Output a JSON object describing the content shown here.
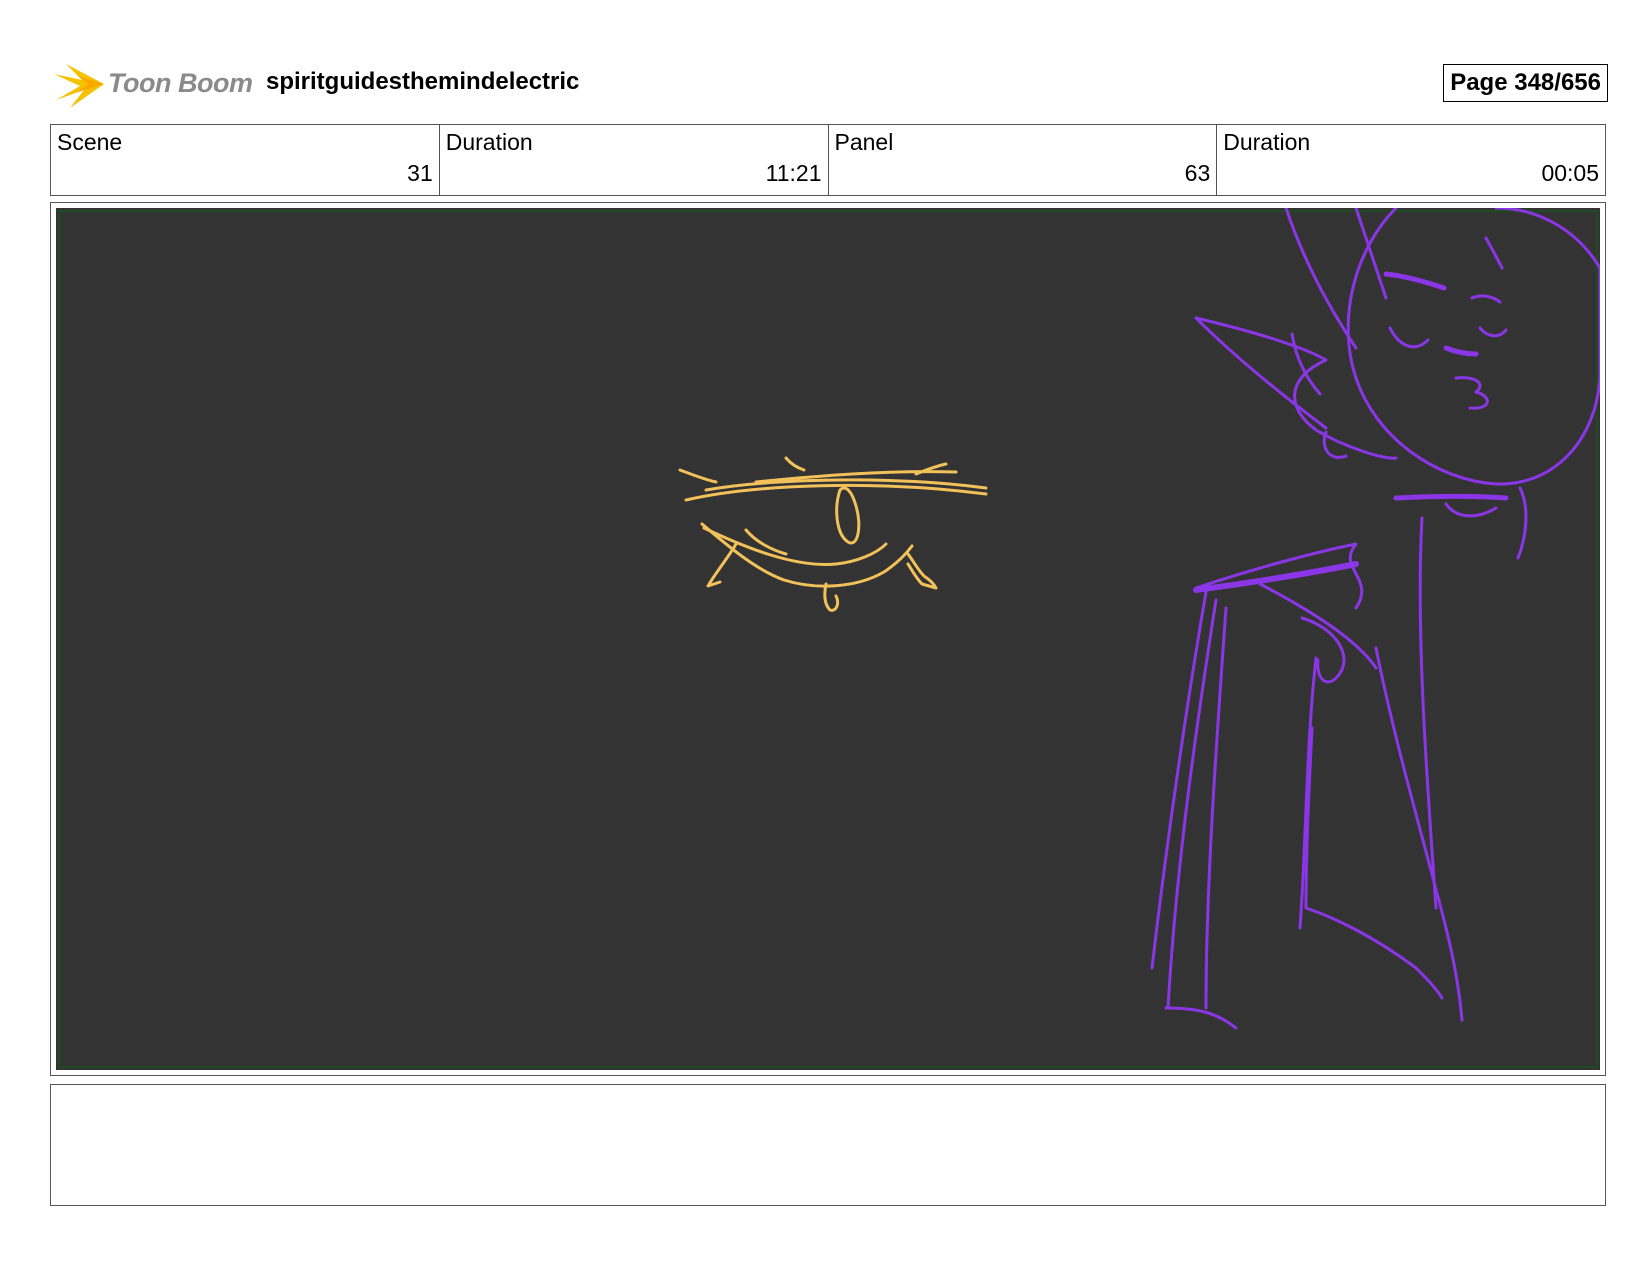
{
  "header": {
    "logo_text": "Toon Boom",
    "project_title": "spiritguidesthemindelectric",
    "page_label": "Page 348/656"
  },
  "info": {
    "scene_label": "Scene",
    "scene_value": "31",
    "scene_duration_label": "Duration",
    "scene_duration_value": "11:21",
    "panel_label": "Panel",
    "panel_value": "63",
    "panel_duration_label": "Duration",
    "panel_duration_value": "00:05"
  },
  "colors": {
    "canvas_bg": "#333333",
    "sketch_yellow": "#f2c15a",
    "sketch_purple": "#8a35e6",
    "logo_yellow": "#f5c200"
  }
}
